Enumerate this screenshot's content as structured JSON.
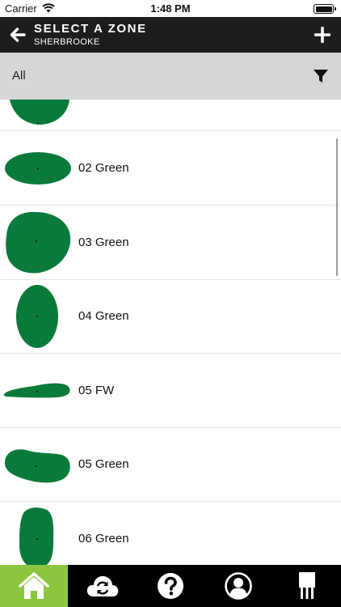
{
  "status_bar": {
    "carrier": "Carrier",
    "time": "1:48 PM"
  },
  "header": {
    "title": "SELECT A ZONE",
    "subtitle": "SHERBROOKE"
  },
  "filter": {
    "label": "All"
  },
  "zones": [
    {
      "name": ""
    },
    {
      "name": "02 Green"
    },
    {
      "name": "03 Green"
    },
    {
      "name": "04 Green"
    },
    {
      "name": "05 FW"
    },
    {
      "name": "05 Green"
    },
    {
      "name": "06 Green"
    }
  ],
  "colors": {
    "accent": "#8cc63f",
    "zone_fill": "#0a7a3b",
    "nav_bg": "#1d1d1d",
    "filter_bg": "#d6d6d6"
  },
  "tabs": [
    {
      "icon": "home-icon",
      "active": true
    },
    {
      "icon": "cloud-sync-icon",
      "active": false
    },
    {
      "icon": "help-icon",
      "active": false
    },
    {
      "icon": "user-profile-icon",
      "active": false
    },
    {
      "icon": "device-icon",
      "active": false
    }
  ]
}
